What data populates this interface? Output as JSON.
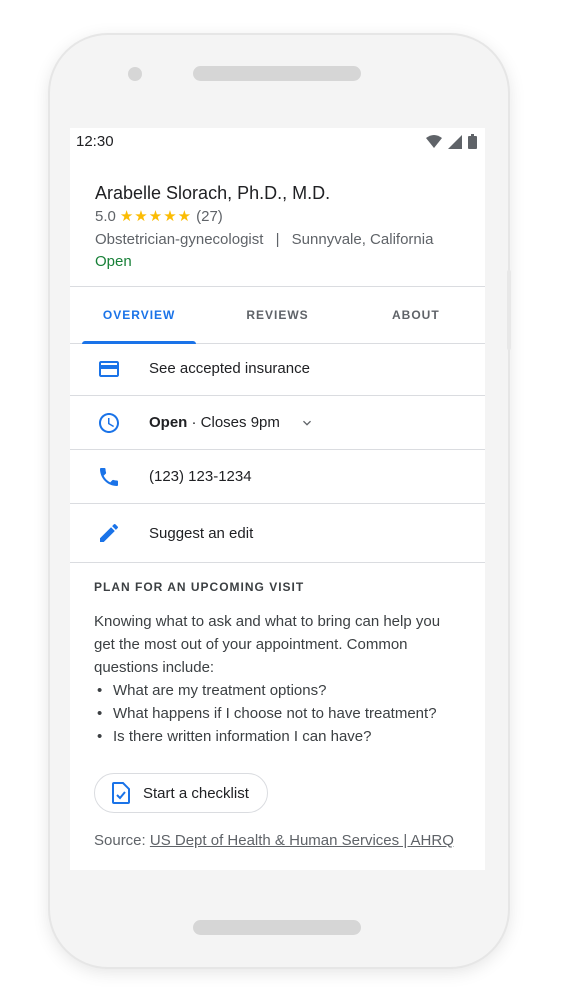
{
  "status_bar": {
    "time": "12:30"
  },
  "profile": {
    "name": "Arabelle Slorach, Ph.D., M.D.",
    "rating": "5.0",
    "stars": "★★★★★",
    "review_count": "(27)",
    "specialty": "Obstetrician-gynecologist",
    "separator": "|",
    "location": "Sunnyvale, California",
    "status": "Open"
  },
  "tabs": [
    {
      "label": "OVERVIEW",
      "active": true
    },
    {
      "label": "REVIEWS",
      "active": false
    },
    {
      "label": "ABOUT",
      "active": false
    }
  ],
  "info_rows": {
    "insurance": "See accepted insurance",
    "hours_status": "Open",
    "hours_detail": " · Closes 9pm",
    "phone": "(123) 123-1234",
    "suggest_edit": "Suggest an edit"
  },
  "plan": {
    "title": "PLAN FOR AN UPCOMING VISIT",
    "body": "Knowing what to ask and what to bring can help you get the most out of your appointment. Common questions include:",
    "questions": [
      "What are my treatment options?",
      "What happens if I choose not to have treatment?",
      "Is there written information I can have?"
    ],
    "checklist_label": "Start a checklist",
    "source_prefix": "Source: ",
    "source_link": "US Dept of Health & Human Services | AHRQ"
  },
  "colors": {
    "accent": "#1a73e8",
    "open": "#188038",
    "star": "#fbbc04"
  }
}
